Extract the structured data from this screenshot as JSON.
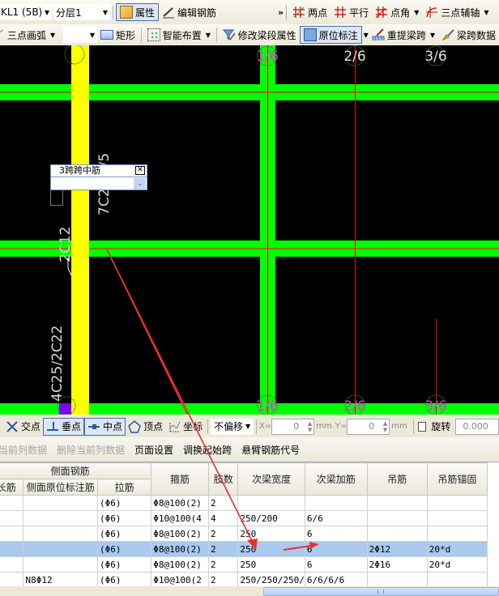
{
  "toolbar1": {
    "element_combo": "KL1 (5B)",
    "layer_combo": "分层1",
    "properties": "属性",
    "edit_rebar": "编辑钢筋",
    "overflow": "»",
    "two_point": "两点",
    "parallel": "平行",
    "point_angle": "点角",
    "three_point_axis": "三点辅轴"
  },
  "toolbar2": {
    "three_point_arc": "三点画弧",
    "blank_combo": "",
    "rectangle": "矩形",
    "smart_layout": "智能布置",
    "modify_segment": "修改梁段属性",
    "in_situ_annotation": "原位标注",
    "re_extract_span": "重提梁跨",
    "span_data": "梁跨数据"
  },
  "canvas": {
    "colors": {
      "beam": "#00ff00",
      "column": "#ffff00",
      "axis": "#ff0000",
      "text": "#d0d0d0",
      "magenta": "#cc44cc"
    },
    "axis_labels_top": [
      "1/6",
      "2/6",
      "3/6"
    ],
    "axis_labels_bottom": [
      "1/6",
      "2/6",
      "3/6"
    ],
    "rebar_labels": [
      "7C25 4/5",
      "2C12",
      "4C25/2C22"
    ],
    "popup": {
      "title": "3跨跨中筋",
      "value": ""
    }
  },
  "snapbar": {
    "intersection": "交点",
    "perpendicular": "垂点",
    "midpoint": "中点",
    "vertex": "顶点",
    "coordinate": "坐标",
    "offset_combo": "不偏移",
    "x_label": "X=",
    "x_value": "0",
    "y_label": "Y=",
    "y_value": "0",
    "unit": "mm",
    "rotate_label": "旋转",
    "rotate_value": "0.000"
  },
  "menubar": {
    "items": [
      {
        "label": "当前列数据",
        "disabled": true
      },
      {
        "label": "删除当前列数据",
        "disabled": true
      },
      {
        "label": "页面设置",
        "disabled": false
      },
      {
        "label": "调换起始跨",
        "disabled": false
      },
      {
        "label": "悬臂钢筋代号",
        "disabled": false
      }
    ]
  },
  "grid": {
    "group_header": "侧面钢筋",
    "headers": [
      "长筋",
      "侧面原位标注筋",
      "拉筋",
      "箍筋",
      "肢数",
      "次梁宽度",
      "次梁加筋",
      "吊筋",
      "吊筋锚固"
    ],
    "rows": [
      [
        "",
        "",
        "(Φ6)",
        "Φ8@100(2)",
        "2",
        "",
        "",
        "",
        ""
      ],
      [
        "",
        "",
        "(Φ6)",
        "Φ10@100(4",
        "4",
        "250/200",
        "6/6",
        "",
        ""
      ],
      [
        "",
        "",
        "(Φ6)",
        "Φ8@100(2)",
        "2",
        "250",
        "6",
        "",
        ""
      ],
      [
        "",
        "",
        "(Φ6)",
        "Φ8@100(2)",
        "2",
        "250",
        "6",
        "2Φ12",
        "20*d"
      ],
      [
        "",
        "",
        "(Φ6)",
        "Φ8@100(2)",
        "2",
        "250",
        "6",
        "2Φ16",
        "20*d"
      ],
      [
        "",
        "N8Φ12",
        "(Φ6)",
        "Φ10@100(2",
        "2",
        "250/250/250/",
        "6/6/6/6",
        "",
        ""
      ]
    ],
    "selected_row": 3
  }
}
